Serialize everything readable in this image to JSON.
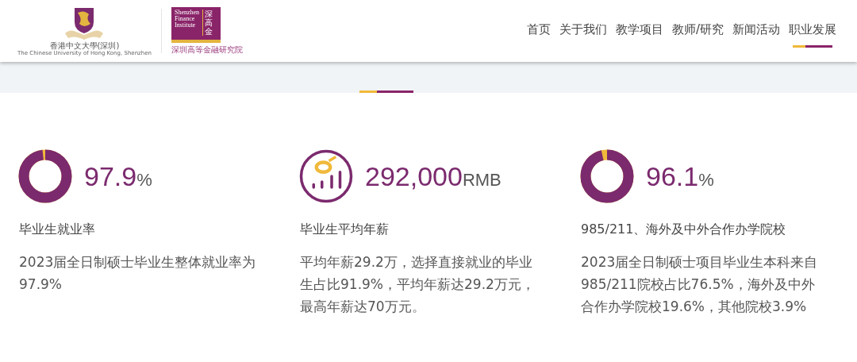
{
  "header": {
    "cuhk_logo": {
      "name_zh": "香港中文大學(深圳)",
      "name_en": "The Chinese University of Hong Kong, Shenzhen"
    },
    "sfi_logo": {
      "lines": [
        "Shenzhen",
        "Finance",
        "Institute"
      ],
      "mark": "深高金",
      "name_zh": "深圳高等金融研究院"
    },
    "nav": [
      {
        "label": "首页",
        "selected": false
      },
      {
        "label": "关于我们",
        "selected": false
      },
      {
        "label": "教学项目",
        "selected": false
      },
      {
        "label": "教师/研究",
        "selected": false
      },
      {
        "label": "新闻活动",
        "selected": false
      },
      {
        "label": "职业发展",
        "selected": true
      }
    ]
  },
  "stats": [
    {
      "kind": "donut",
      "level": 0.979,
      "value": "97.9",
      "unit": "%",
      "label": "毕业生就业率",
      "description": "2023届全日制硕士毕业生整体就业率为97.9%"
    },
    {
      "kind": "salary",
      "value": "292,000",
      "unit": "RMB",
      "label": "毕业生平均年薪",
      "description": "平均年薪29.2万，选择直接就业的毕业生占比91.9%，平均年薪达29.2万元，最高年薪达70万元。"
    },
    {
      "kind": "donut",
      "level": 0.961,
      "value": "96.1",
      "unit": "%",
      "label": "985/211、海外及中外合作办学院校",
      "description": "2023届全日制硕士项目毕业生本科来自985/211院校占比76.5%，海外及中外合作办学院校19.6%，其他院校3.9%"
    }
  ]
}
